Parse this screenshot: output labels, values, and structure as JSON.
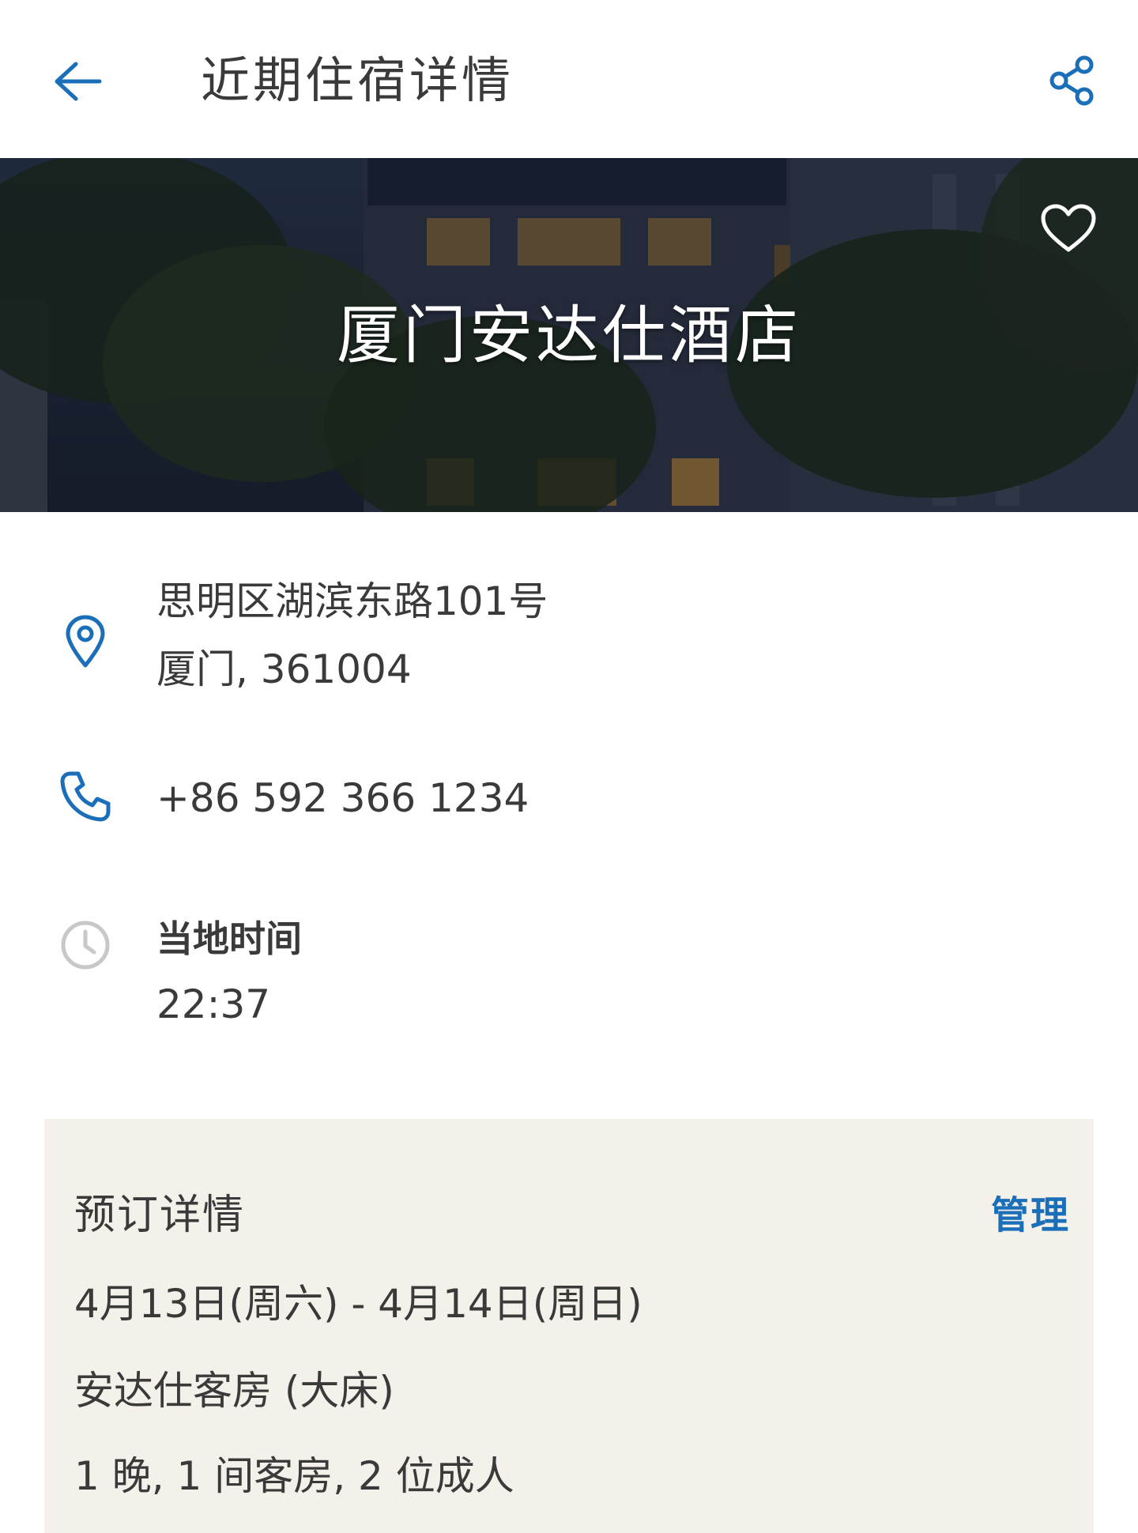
{
  "header": {
    "title": "近期住宿详情",
    "back_icon": "arrow-left-icon",
    "share_icon": "share-icon"
  },
  "hotel": {
    "name": "厦门安达仕酒店",
    "favorite_icon": "heart-outline-icon"
  },
  "contact": {
    "address_line1": "思明区湖滨东路101号",
    "address_line2": "厦门, 361004",
    "phone": "+86 592 366 1234",
    "local_time_label": "当地时间",
    "local_time": "22:37"
  },
  "booking": {
    "title": "预订详情",
    "manage_label": "管理",
    "dates": "4月13日(周六) - 4月14日(周日)",
    "room_type": "安达仕客房 (大床)",
    "summary": "1 晚, 1 间客房, 2 位成人"
  },
  "colors": {
    "accent": "#1b6fb8",
    "card_bg": "#f4f0ea",
    "text": "#3a3a3a",
    "clock_icon": "#c8c8c8"
  }
}
